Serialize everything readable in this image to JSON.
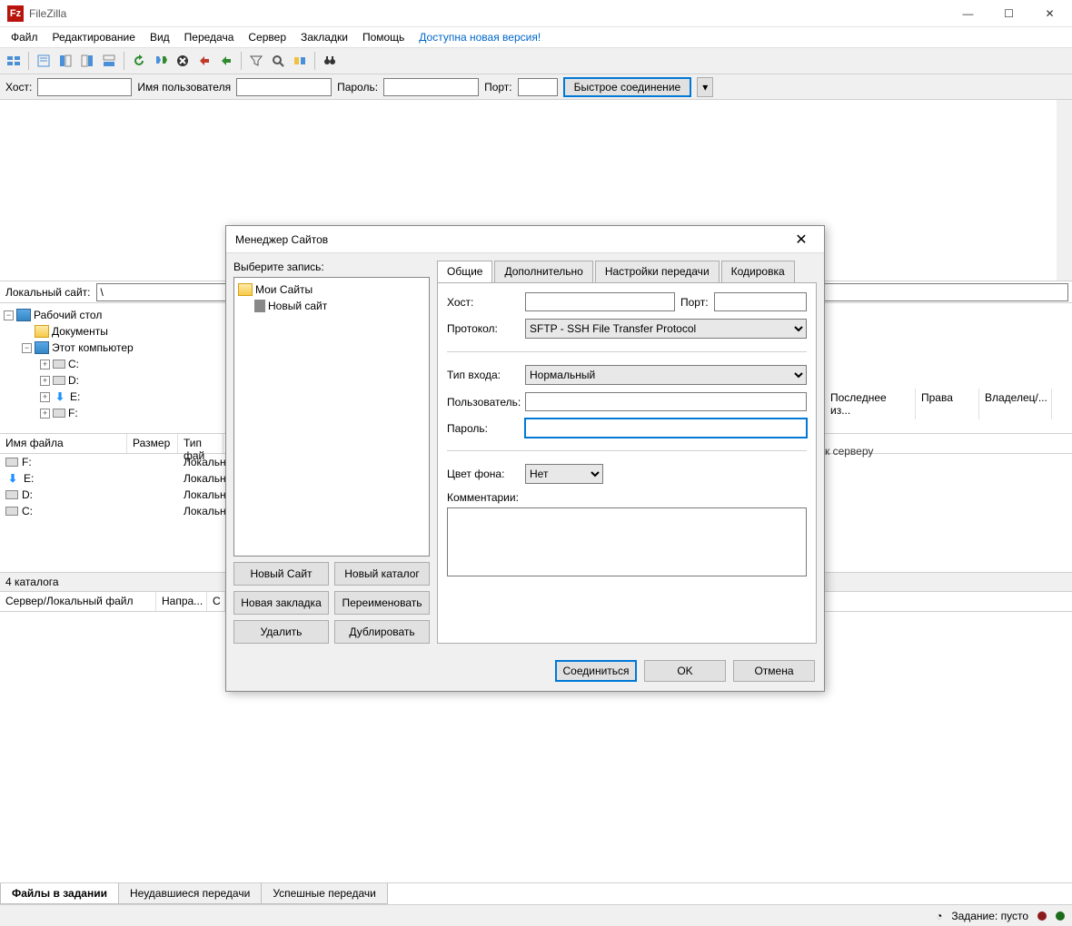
{
  "app": {
    "title": "FileZilla"
  },
  "window_controls": {
    "min": "—",
    "max": "☐",
    "close": "✕"
  },
  "menu": {
    "file": "Файл",
    "edit": "Редактирование",
    "view": "Вид",
    "transfer": "Передача",
    "server": "Сервер",
    "bookmarks": "Закладки",
    "help": "Помощь",
    "update": "Доступна новая версия!"
  },
  "quickconnect": {
    "host_label": "Хост:",
    "user_label": "Имя пользователя",
    "pass_label": "Пароль:",
    "port_label": "Порт:",
    "button": "Быстрое соединение",
    "host": "",
    "user": "",
    "pass": "",
    "port": ""
  },
  "local": {
    "site_label": "Локальный сайт:",
    "path": "\\",
    "tree": {
      "root": "Рабочий стол",
      "documents": "Документы",
      "this_pc": "Этот компьютер",
      "drives": [
        "C:",
        "D:",
        "E:",
        "F:"
      ]
    },
    "columns": {
      "name": "Имя файла",
      "size": "Размер",
      "type": "Тип фай"
    },
    "rows": [
      {
        "name": "F:",
        "type": "Локальн"
      },
      {
        "name": "E:",
        "type": "Локальн"
      },
      {
        "name": "D:",
        "type": "Локальн"
      },
      {
        "name": "C:",
        "type": "Локальн"
      }
    ],
    "status": "4 каталога"
  },
  "remote": {
    "columns": {
      "last": "Последнее из...",
      "perm": "Права",
      "owner": "Владелец/..."
    },
    "message": "к серверу"
  },
  "queue": {
    "col_server": "Сервер/Локальный файл",
    "col_dir": "Напра...",
    "col_other": "С"
  },
  "bottom_tabs": {
    "files": "Файлы в задании",
    "failed": "Неудавшиеся передачи",
    "success": "Успешные передачи"
  },
  "statusbar": {
    "queue": "Задание: пусто"
  },
  "dialog": {
    "title": "Менеджер Сайтов",
    "select_label": "Выберите запись:",
    "tree": {
      "root": "Мои Сайты",
      "site": "Новый сайт"
    },
    "buttons": {
      "new_site": "Новый Сайт",
      "new_folder": "Новый каталог",
      "new_bookmark": "Новая закладка",
      "rename": "Переименовать",
      "delete": "Удалить",
      "duplicate": "Дублировать"
    },
    "tabs": {
      "general": "Общие",
      "extra": "Дополнительно",
      "transfer": "Настройки передачи",
      "encoding": "Кодировка"
    },
    "fields": {
      "host_label": "Хост:",
      "port_label": "Порт:",
      "protocol_label": "Протокол:",
      "protocol_value": "SFTP - SSH File Transfer Protocol",
      "logon_label": "Тип входа:",
      "logon_value": "Нормальный",
      "user_label": "Пользователь:",
      "pass_label": "Пароль:",
      "bgcolor_label": "Цвет фона:",
      "bgcolor_value": "Нет",
      "comments_label": "Комментарии:",
      "host": "",
      "port": "",
      "user": "",
      "pass": "",
      "comments": ""
    },
    "footer": {
      "connect": "Соединиться",
      "ok": "OK",
      "cancel": "Отмена"
    }
  }
}
